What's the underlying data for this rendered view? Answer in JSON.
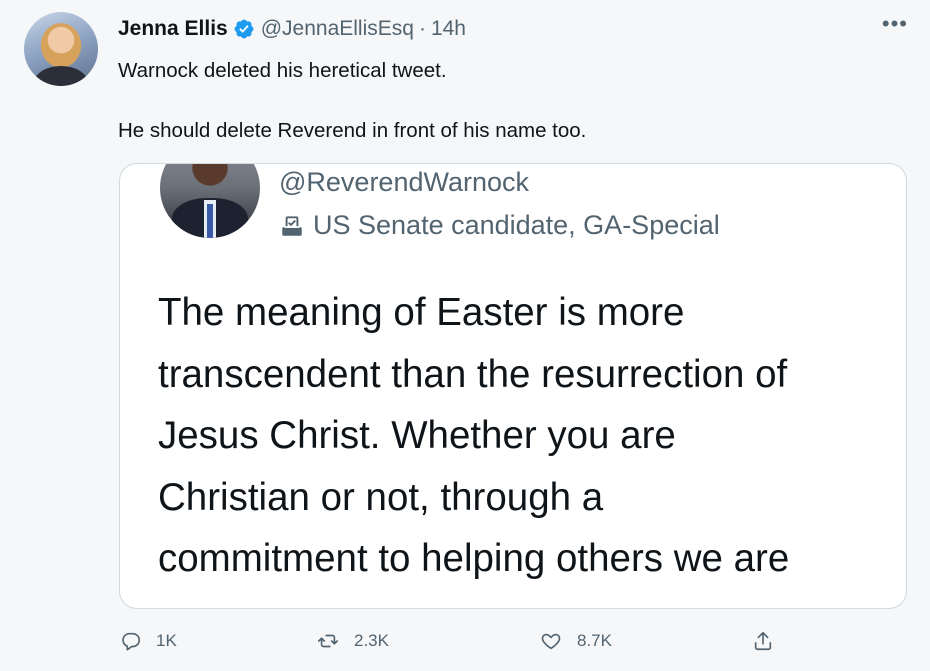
{
  "tweet": {
    "author_name": "Jenna Ellis",
    "handle": "@JennaEllisEsq",
    "separator": "·",
    "time": "14h",
    "more_label": "•••",
    "text_line1": "Warnock deleted his heretical tweet.",
    "text_line2": "He should delete Reverend in front of his name too."
  },
  "embedded_screenshot": {
    "handle": "@ReverendWarnock",
    "label": "US Senate candidate, GA-Special",
    "body_lines": [
      "The meaning of Easter is more",
      "transcendent than the resurrection of",
      "Jesus Christ. Whether you are",
      "Christian or not, through a",
      "commitment to helping others we are"
    ]
  },
  "actions": {
    "reply_count": "1K",
    "retweet_count": "2.3K",
    "like_count": "8.7K"
  },
  "icons": {
    "verified": "verified-badge-icon",
    "reply": "reply-icon",
    "retweet": "retweet-icon",
    "like": "heart-icon",
    "share": "share-icon",
    "ballot": "ballot-box-icon"
  },
  "colors": {
    "verified_blue": "#1d9bf0",
    "secondary_text": "#536471",
    "background": "#f5f7f8"
  }
}
